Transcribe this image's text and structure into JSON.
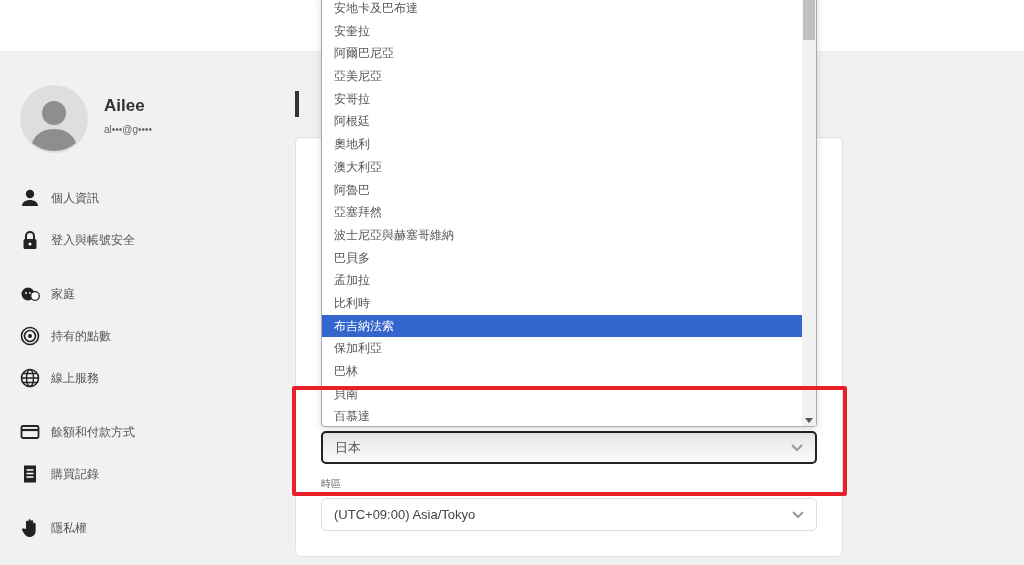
{
  "profile": {
    "name": "Ailee",
    "email": "al•••@g••••"
  },
  "sidebar": {
    "groups": [
      [
        {
          "kind": "person",
          "label": "個人資訊"
        },
        {
          "kind": "lock",
          "label": "登入與帳號安全"
        }
      ],
      [
        {
          "kind": "family",
          "label": "家庭"
        },
        {
          "kind": "points",
          "label": "持有的點數"
        },
        {
          "kind": "globe",
          "label": "線上服務"
        }
      ],
      [
        {
          "kind": "card",
          "label": "餘額和付款方式"
        },
        {
          "kind": "receipt",
          "label": "購買記錄"
        }
      ],
      [
        {
          "kind": "hand",
          "label": "隱私權"
        }
      ]
    ]
  },
  "country_dropdown": {
    "options": [
      {
        "label": "安地卡及巴布達",
        "selected": false
      },
      {
        "label": "安奎拉",
        "selected": false
      },
      {
        "label": "阿爾巴尼亞",
        "selected": false
      },
      {
        "label": "亞美尼亞",
        "selected": false
      },
      {
        "label": "安哥拉",
        "selected": false
      },
      {
        "label": "阿根廷",
        "selected": false
      },
      {
        "label": "奧地利",
        "selected": false
      },
      {
        "label": "澳大利亞",
        "selected": false
      },
      {
        "label": "阿魯巴",
        "selected": false
      },
      {
        "label": "亞塞拜然",
        "selected": false
      },
      {
        "label": "波士尼亞與赫塞哥維納",
        "selected": false
      },
      {
        "label": "巴貝多",
        "selected": false
      },
      {
        "label": "孟加拉",
        "selected": false
      },
      {
        "label": "比利時",
        "selected": false
      },
      {
        "label": "布吉納法索",
        "selected": true
      },
      {
        "label": "保加利亞",
        "selected": false
      },
      {
        "label": "巴林",
        "selected": false
      },
      {
        "label": "貝南",
        "selected": false
      },
      {
        "label": "百慕達",
        "selected": false
      }
    ]
  },
  "country_select": {
    "value": "日本",
    "focused": true
  },
  "timezone": {
    "label": "時區",
    "value": "(UTC+09:00) Asia/Tokyo"
  }
}
